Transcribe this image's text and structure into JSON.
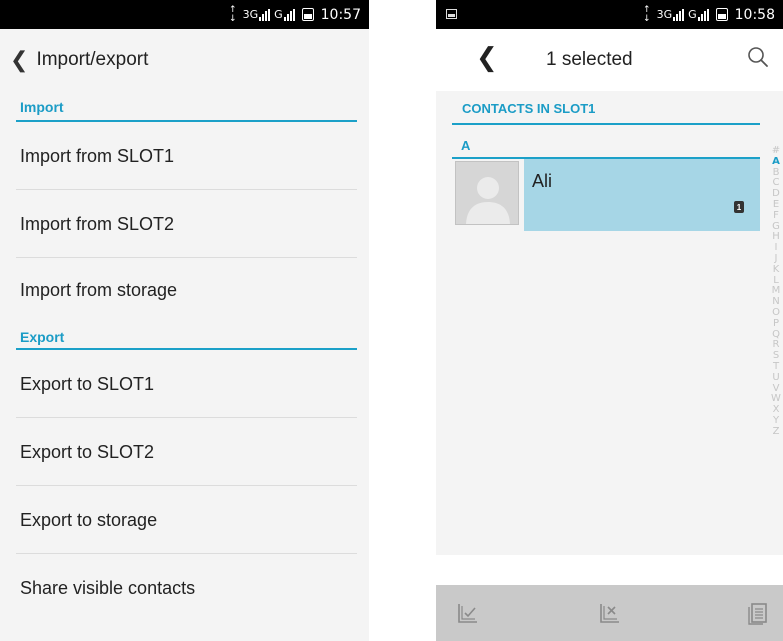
{
  "left": {
    "status": {
      "time": "10:57",
      "network": "3G"
    },
    "header": {
      "title": "Import/export"
    },
    "import_section": "Import",
    "import_items": [
      "Import from SLOT1",
      "Import from SLOT2",
      "Import from storage"
    ],
    "export_section": "Export",
    "export_items": [
      "Export to SLOT1",
      "Export to SLOT2",
      "Export to storage",
      "Share visible contacts"
    ]
  },
  "right": {
    "status": {
      "time": "10:58",
      "network": "3G"
    },
    "header": {
      "title": "1 selected"
    },
    "section": "CONTACTS IN SLOT1",
    "letter": "A",
    "contact": {
      "name": "Ali",
      "slot_badge": "1"
    },
    "alphabet": [
      "#",
      "A",
      "B",
      "C",
      "D",
      "E",
      "F",
      "G",
      "H",
      "I",
      "J",
      "K",
      "L",
      "M",
      "N",
      "O",
      "P",
      "Q",
      "R",
      "S",
      "T",
      "U",
      "V",
      "W",
      "X",
      "Y",
      "Z"
    ],
    "alphabet_active": "A"
  },
  "colors": {
    "accent": "#1ba0c8",
    "selection": "#a6d6e6",
    "bottombar": "#c9c9c9"
  }
}
